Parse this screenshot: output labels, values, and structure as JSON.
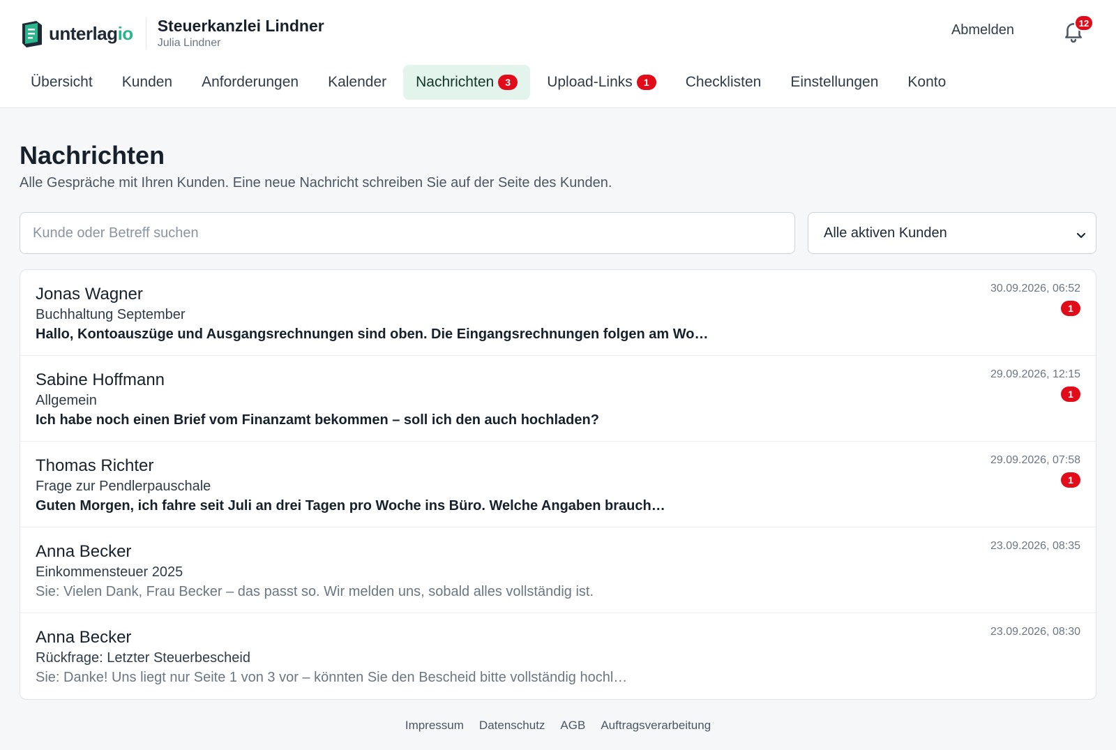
{
  "brand": {
    "logo_text_main": "unterlag",
    "logo_text_accent": "io",
    "logo_icon": "unterlagio-logo-icon",
    "accent_color": "#2bb58c",
    "firm_name": "Steuerkanzlei Lindner",
    "user_name": "Julia Lindner"
  },
  "header": {
    "logout_label": "Abmelden",
    "bell_icon": "bell-icon",
    "notification_count": "12"
  },
  "nav": {
    "tabs": [
      {
        "label": "Übersicht",
        "badge": "",
        "active": false
      },
      {
        "label": "Kunden",
        "badge": "",
        "active": false
      },
      {
        "label": "Anforderungen",
        "badge": "",
        "active": false
      },
      {
        "label": "Kalender",
        "badge": "",
        "active": false
      },
      {
        "label": "Nachrichten",
        "badge": "3",
        "active": true
      },
      {
        "label": "Upload-Links",
        "badge": "1",
        "active": false
      },
      {
        "label": "Checklisten",
        "badge": "",
        "active": false
      },
      {
        "label": "Einstellungen",
        "badge": "",
        "active": false
      },
      {
        "label": "Konto",
        "badge": "",
        "active": false
      }
    ],
    "active_color": "#e2f4ec",
    "badge_color": "#e10b1a"
  },
  "page": {
    "title": "Nachrichten",
    "description": "Alle Gespräche mit Ihren Kunden. Eine neue Nachricht schreiben Sie auf der Seite des Kunden."
  },
  "filters": {
    "search_placeholder": "Kunde oder Betreff suchen",
    "search_value": "",
    "select_value": "Alle aktiven Kunden",
    "select_icon": "chevron-down-icon"
  },
  "conversations": [
    {
      "name": "Jonas Wagner",
      "subject": "Buchhaltung September",
      "preview": "Hallo, Kontoauszüge und Ausgangsrechnungen sind oben. Die Eingangsrechnungen folgen am Wo…",
      "date": "30.09.2026, 06:52",
      "unread": "1"
    },
    {
      "name": "Sabine Hoffmann",
      "subject": "Allgemein",
      "preview": "Ich habe noch einen Brief vom Finanzamt bekommen – soll ich den auch hochladen?",
      "date": "29.09.2026, 12:15",
      "unread": "1"
    },
    {
      "name": "Thomas Richter",
      "subject": "Frage zur Pendlerpauschale",
      "preview": "Guten Morgen, ich fahre seit Juli an drei Tagen pro Woche ins Büro. Welche Angaben brauch…",
      "date": "29.09.2026, 07:58",
      "unread": "1"
    },
    {
      "name": "Anna Becker",
      "subject": "Einkommensteuer 2025",
      "preview": "Sie: Vielen Dank, Frau Becker – das passt so. Wir melden uns, sobald alles vollständig ist.",
      "date": "23.09.2026, 08:35",
      "unread": ""
    },
    {
      "name": "Anna Becker",
      "subject": "Rückfrage: Letzter Steuerbescheid",
      "preview": "Sie: Danke! Uns liegt nur Seite 1 von 3 vor – könnten Sie den Bescheid bitte vollständig hochl…",
      "date": "23.09.2026, 08:30",
      "unread": ""
    }
  ],
  "footer": {
    "links": [
      "Impressum",
      "Datenschutz",
      "AGB",
      "Auftragsverarbeitung"
    ]
  }
}
